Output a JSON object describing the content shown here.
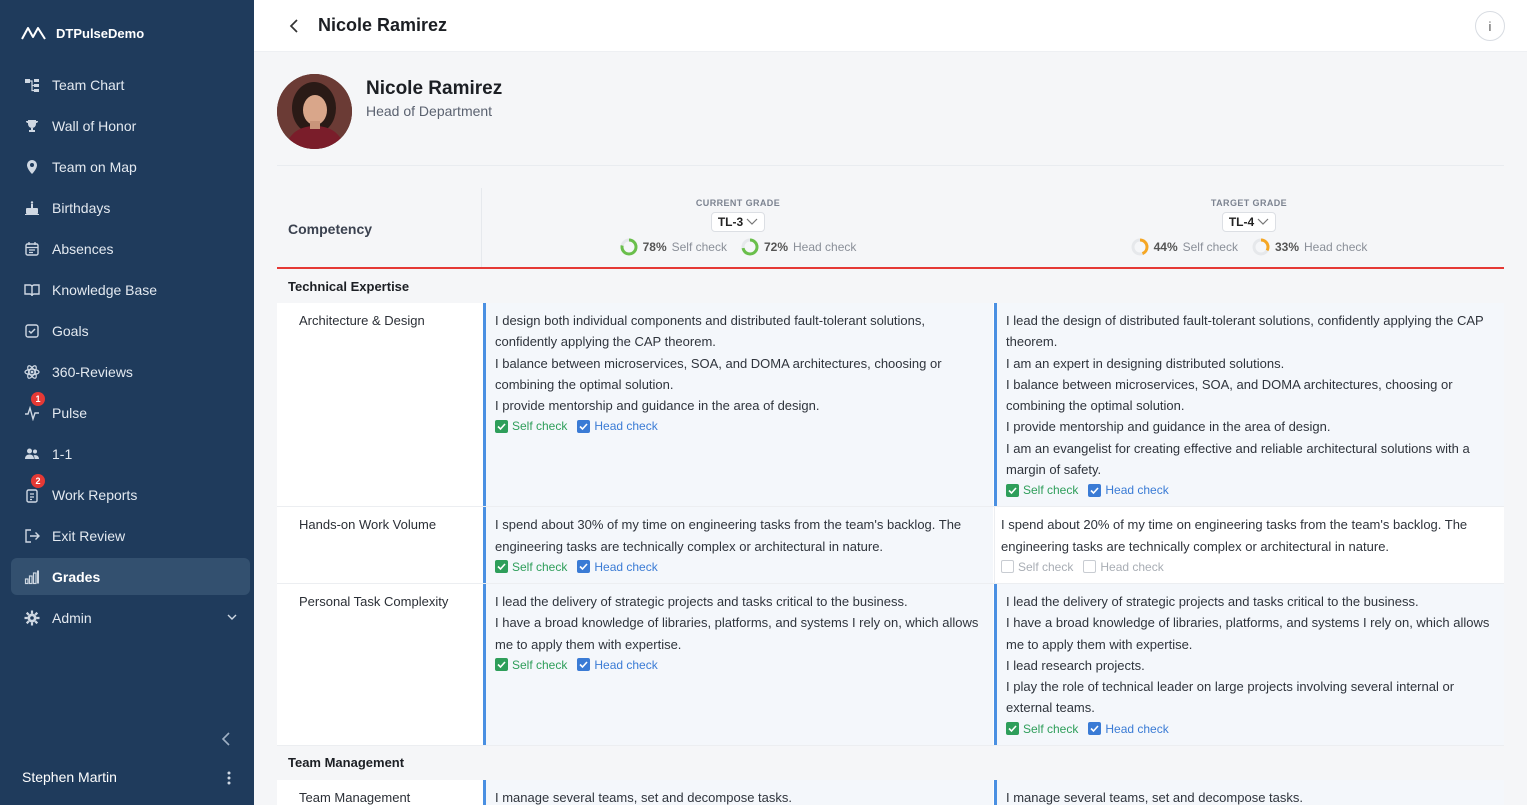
{
  "app": {
    "name": "DTPulseDemo"
  },
  "sidebar": {
    "items": [
      {
        "label": "Team Chart",
        "icon": "team-chart-icon"
      },
      {
        "label": "Wall of Honor",
        "icon": "trophy-icon"
      },
      {
        "label": "Team on Map",
        "icon": "map-pin-icon"
      },
      {
        "label": "Birthdays",
        "icon": "cake-icon"
      },
      {
        "label": "Absences",
        "icon": "calendar-icon"
      },
      {
        "label": "Knowledge Base",
        "icon": "book-icon"
      },
      {
        "label": "Goals",
        "icon": "checkbox-icon"
      },
      {
        "label": "360-Reviews",
        "icon": "atom-icon"
      },
      {
        "label": "Pulse",
        "icon": "pulse-icon",
        "badge": "1"
      },
      {
        "label": "1-1",
        "icon": "users-icon"
      },
      {
        "label": "Work Reports",
        "icon": "report-icon",
        "badge": "2"
      },
      {
        "label": "Exit Review",
        "icon": "exit-icon"
      },
      {
        "label": "Grades",
        "icon": "bar-chart-icon",
        "active": true
      },
      {
        "label": "Admin",
        "icon": "gear-icon",
        "expandable": true
      }
    ],
    "user": "Stephen Martin"
  },
  "header": {
    "title": "Nicole Ramirez"
  },
  "profile": {
    "name": "Nicole Ramirez",
    "role": "Head of Department"
  },
  "table": {
    "competency_header": "Competency",
    "current": {
      "label": "CURRENT GRADE",
      "grade": "TL-3",
      "self_pct": "78%",
      "self_label": "Self check",
      "head_pct": "72%",
      "head_label": "Head check",
      "self_fraction": 0.78,
      "head_fraction": 0.72,
      "color": "#6abf4b"
    },
    "target": {
      "label": "TARGET GRADE",
      "grade": "TL-4",
      "self_pct": "44%",
      "self_label": "Self check",
      "head_pct": "33%",
      "head_label": "Head check",
      "self_fraction": 0.44,
      "head_fraction": 0.33,
      "color": "#f5a623"
    },
    "sections": [
      {
        "title": "Technical Expertise"
      },
      {
        "title": "Team Management"
      }
    ],
    "rows": [
      {
        "name": "Architecture & Design",
        "current": [
          "I design both individual components and distributed fault-tolerant solutions, confidently applying the CAP theorem.",
          "I balance between microservices, SOA, and DOMA architectures, choosing or combining the optimal solution.",
          "I provide mentorship and guidance in the area of design."
        ],
        "target": [
          "I lead the design of distributed fault-tolerant solutions, confidently applying the CAP theorem.",
          "I am an expert in designing distributed solutions.",
          "I balance between microservices, SOA, and DOMA architectures, choosing or combining the optimal solution.",
          "I provide mentorship and guidance in the area of design.",
          "I am an evangelist for creating effective and reliable architectural solutions with a margin of safety."
        ]
      },
      {
        "name": "Hands-on Work Volume",
        "current": [
          "I spend about 30% of my time on engineering tasks from the team's backlog. The engineering tasks are technically complex or architectural in nature."
        ],
        "target": [
          "I spend about 20% of my time on engineering tasks from the team's backlog. The engineering tasks are technically complex or architectural in nature."
        ]
      },
      {
        "name": "Personal Task Complexity",
        "current": [
          "I lead the delivery of strategic projects and tasks critical to the business.",
          "I have a broad knowledge of libraries, platforms, and systems I rely on, which allows me to apply them with expertise."
        ],
        "target": [
          "I lead the delivery of strategic projects and tasks critical to the business.",
          "I have a broad knowledge of libraries, platforms, and systems I rely on, which allows me to apply them with expertise.",
          "I lead research projects.",
          "I play the role of technical leader on large projects involving several internal or external teams."
        ]
      },
      {
        "name": "Team Management",
        "current": [
          "I manage several teams, set and decompose tasks."
        ],
        "target": [
          "I manage several teams, set and decompose tasks."
        ]
      }
    ],
    "check_labels": {
      "self": "Self check",
      "head": "Head check"
    }
  }
}
